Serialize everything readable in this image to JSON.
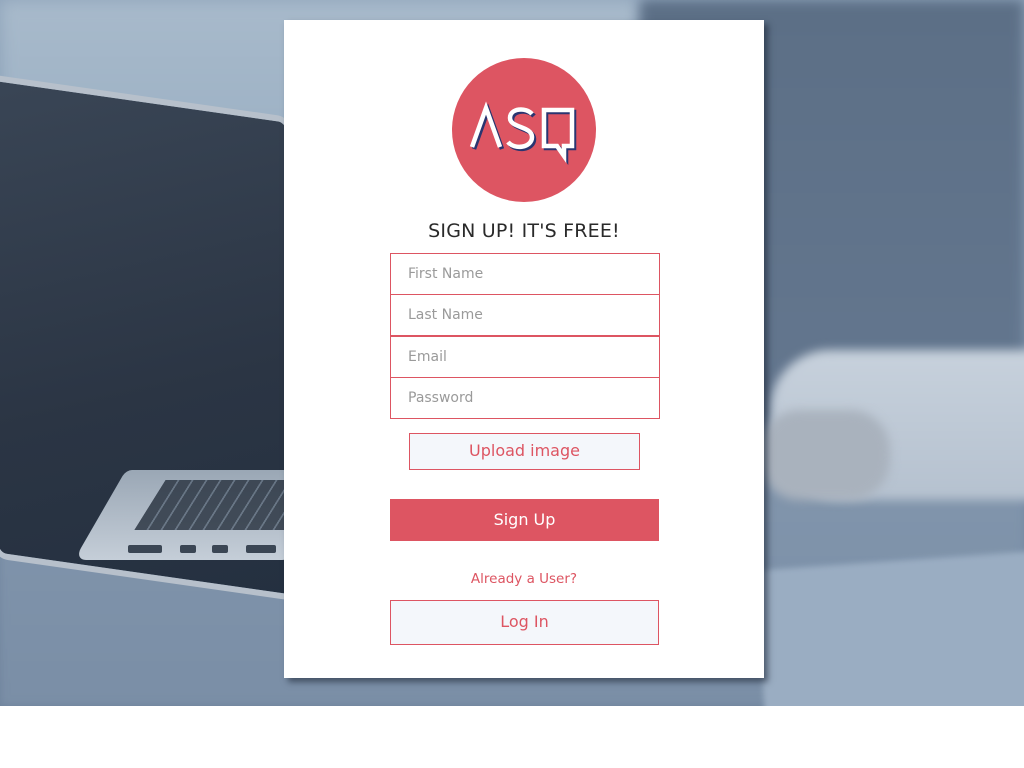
{
  "brand": {
    "logo_text": "ASQ",
    "logo_color": "#dd5562"
  },
  "form": {
    "title": "SIGN UP! IT'S FREE!",
    "first_name_placeholder": "First Name",
    "last_name_placeholder": "Last Name",
    "email_placeholder": "Email",
    "password_placeholder": "Password",
    "first_name_value": "",
    "last_name_value": "",
    "email_value": "",
    "password_value": ""
  },
  "actions": {
    "upload_label": "Upload image",
    "signup_label": "Sign Up",
    "already_user_text": "Already a User?",
    "login_label": "Log In"
  },
  "colors": {
    "accent": "#dd5562",
    "button_light_bg": "#f4f7fb",
    "card_bg": "#ffffff"
  }
}
